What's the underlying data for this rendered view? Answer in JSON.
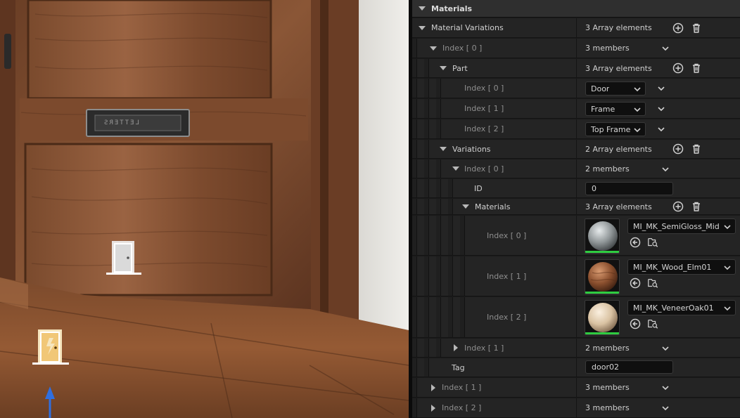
{
  "viewport": {
    "plaque_text": "LETTERS",
    "icons": [
      "door-actor-icon",
      "door-actor-selected-icon",
      "transform-gizmo-arrow-icon"
    ]
  },
  "details": {
    "category": "Materials",
    "material_variations": {
      "label": "Material Variations",
      "value": "3 Array elements"
    },
    "index0": {
      "label": "Index [ 0 ]",
      "value": "3 members"
    },
    "part": {
      "label": "Part",
      "value": "3 Array elements"
    },
    "part_items": [
      {
        "label": "Index [ 0 ]",
        "value": "Door"
      },
      {
        "label": "Index [ 1 ]",
        "value": "Frame"
      },
      {
        "label": "Index [ 2 ]",
        "value": "Top Frame"
      }
    ],
    "variations": {
      "label": "Variations",
      "value": "2 Array elements"
    },
    "var_index0": {
      "label": "Index [ 0 ]",
      "value": "2 members"
    },
    "id": {
      "label": "ID",
      "value": "0"
    },
    "materials": {
      "label": "Materials",
      "value": "3 Array elements"
    },
    "material_items": [
      {
        "label": "Index [ 0 ]",
        "asset": "MI_MK_SemiGloss_Mid",
        "thumb_color": "#8f9597"
      },
      {
        "label": "Index [ 1 ]",
        "asset": "MI_MK_Wood_Elm01",
        "thumb_color": "#8a4f2e"
      },
      {
        "label": "Index [ 2 ]",
        "asset": "MI_MK_VeneerOak01",
        "thumb_color": "#d9c2a2"
      }
    ],
    "var_index1": {
      "label": "Index [ 1 ]",
      "value": "2 members"
    },
    "tag": {
      "label": "Tag",
      "value": "door02"
    },
    "index1": {
      "label": "Index [ 1 ]",
      "value": "3 members"
    },
    "index2": {
      "label": "Index [ 2 ]",
      "value": "3 members"
    }
  },
  "colors": {
    "panel_bg": "#1a1a1a",
    "row_bg": "#242424",
    "accent_green": "#2ecc40",
    "gizmo_blue": "#2f6fe0"
  }
}
